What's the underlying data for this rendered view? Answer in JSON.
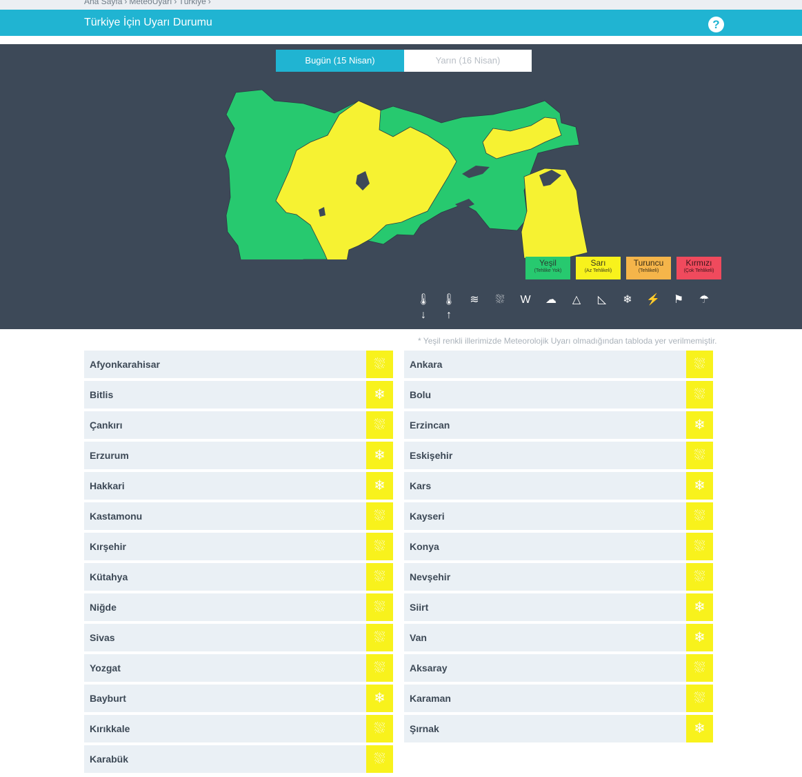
{
  "breadcrumb": [
    "Ana Sayfa",
    "MeteoUyarı",
    "Türkiye"
  ],
  "header": {
    "title": "Türkiye İçin Uyarı Durumu",
    "help_label": "?"
  },
  "tabs": [
    {
      "label": "Bugün (15 Nisan)",
      "active": true
    },
    {
      "label": "Yarın (16 Nisan)",
      "active": false
    }
  ],
  "legend": [
    {
      "label": "Yeşil",
      "sub": "(Tehlike Yok)",
      "color": "#27c96f",
      "text_color": "#2a3a2f"
    },
    {
      "label": "Sarı",
      "sub": "(Az Tehlikeli)",
      "color": "#f8f21c",
      "text_color": "#3a3a20"
    },
    {
      "label": "Turuncu",
      "sub": "(Tehlikeli)",
      "color": "#f5b54a",
      "text_color": "#3a2d15"
    },
    {
      "label": "Kırmızı",
      "sub": "(Çok Tehlikeli)",
      "color": "#f04a5d",
      "text_color": "#3a1519"
    }
  ],
  "warning_icons": [
    "cold-icon",
    "heat-icon",
    "wave-icon",
    "snow-melt-icon",
    "wind-icon",
    "fog-icon",
    "avalanche-icon",
    "landslide-icon",
    "snow-icon",
    "lightning-icon",
    "windsock-icon",
    "rain-icon"
  ],
  "note": "* Yeşil renkli illerimizde Meteorolojik Uyarı olmadığından tabloda yer verilmemiştir.",
  "provinces_left": [
    {
      "name": "Afyonkarahisar",
      "icon": "snow-melt"
    },
    {
      "name": "Bitlis",
      "icon": "snow"
    },
    {
      "name": "Çankırı",
      "icon": "snow-melt"
    },
    {
      "name": "Erzurum",
      "icon": "snow"
    },
    {
      "name": "Hakkari",
      "icon": "snow"
    },
    {
      "name": "Kastamonu",
      "icon": "snow-melt"
    },
    {
      "name": "Kırşehir",
      "icon": "snow-melt"
    },
    {
      "name": "Kütahya",
      "icon": "snow-melt"
    },
    {
      "name": "Niğde",
      "icon": "snow-melt"
    },
    {
      "name": "Sivas",
      "icon": "snow-melt"
    },
    {
      "name": "Yozgat",
      "icon": "snow-melt"
    },
    {
      "name": "Bayburt",
      "icon": "snow"
    },
    {
      "name": "Kırıkkale",
      "icon": "snow-melt"
    },
    {
      "name": "Karabük",
      "icon": "snow-melt"
    }
  ],
  "provinces_right": [
    {
      "name": "Ankara",
      "icon": "snow-melt"
    },
    {
      "name": "Bolu",
      "icon": "snow-melt"
    },
    {
      "name": "Erzincan",
      "icon": "snow"
    },
    {
      "name": "Eskişehir",
      "icon": "snow-melt"
    },
    {
      "name": "Kars",
      "icon": "snow"
    },
    {
      "name": "Kayseri",
      "icon": "snow-melt"
    },
    {
      "name": "Konya",
      "icon": "snow-melt"
    },
    {
      "name": "Nevşehir",
      "icon": "snow-melt"
    },
    {
      "name": "Siirt",
      "icon": "snow"
    },
    {
      "name": "Van",
      "icon": "snow"
    },
    {
      "name": "Aksaray",
      "icon": "snow-melt"
    },
    {
      "name": "Karaman",
      "icon": "snow-melt"
    },
    {
      "name": "Şırnak",
      "icon": "snow"
    }
  ]
}
